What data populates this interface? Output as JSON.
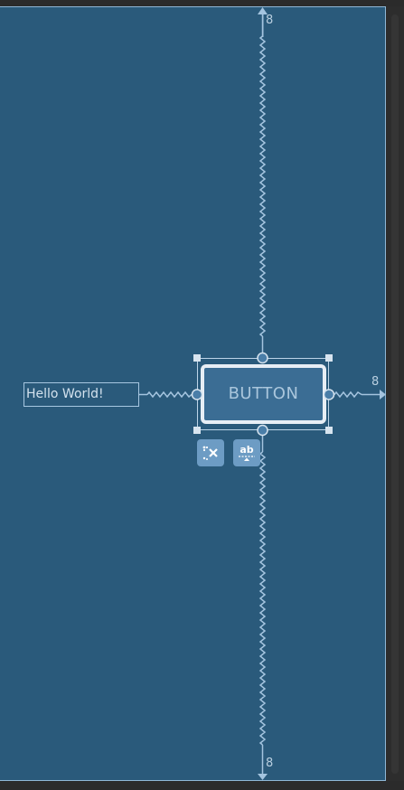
{
  "canvas": {
    "background": "#2a5a7b",
    "border": "#8fb7d6"
  },
  "text_view": {
    "text": "Hello World!"
  },
  "button": {
    "label": "BUTTON"
  },
  "margins": {
    "top": "8",
    "right": "8",
    "bottom": "8"
  },
  "toolbar": {
    "clear_constraints_icon": "clear-constraints-icon",
    "baseline_icon": "baseline-icon"
  },
  "colors": {
    "constraint": "#a4c4df",
    "handle": "#d7e4ef",
    "button_fill": "#3b6d94",
    "tool_button": "#6d9cc4"
  }
}
